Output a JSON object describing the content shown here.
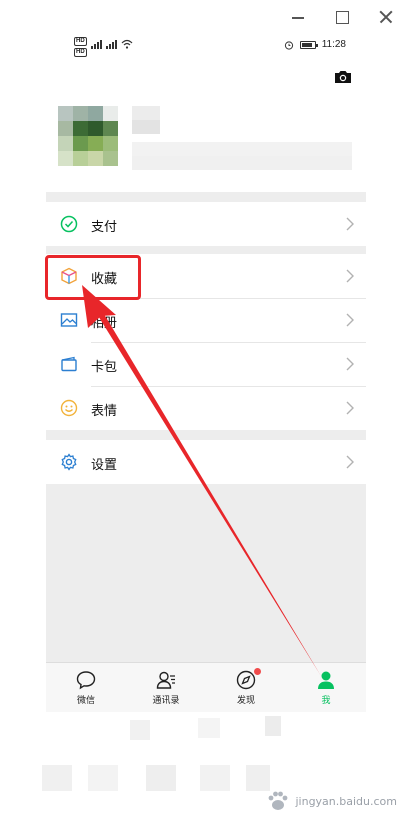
{
  "status_bar": {
    "hd1": "HD",
    "hd2": "HD",
    "sig1": "4G",
    "sig2": "4G",
    "time": "11:28"
  },
  "menu": {
    "pay": "支付",
    "favorites": "收藏",
    "album": "相册",
    "cards": "卡包",
    "stickers": "表情",
    "settings": "设置"
  },
  "tabs": [
    {
      "label": "微信",
      "icon": "chat-bubble-icon"
    },
    {
      "label": "通讯录",
      "icon": "contacts-icon"
    },
    {
      "label": "发现",
      "icon": "compass-icon"
    },
    {
      "label": "我",
      "icon": "person-icon"
    }
  ],
  "colors": {
    "accent_green": "#07c160",
    "highlight_red": "#e8262a",
    "badge_red": "#f04b4b"
  },
  "watermark": "jingyan.baidu.com"
}
